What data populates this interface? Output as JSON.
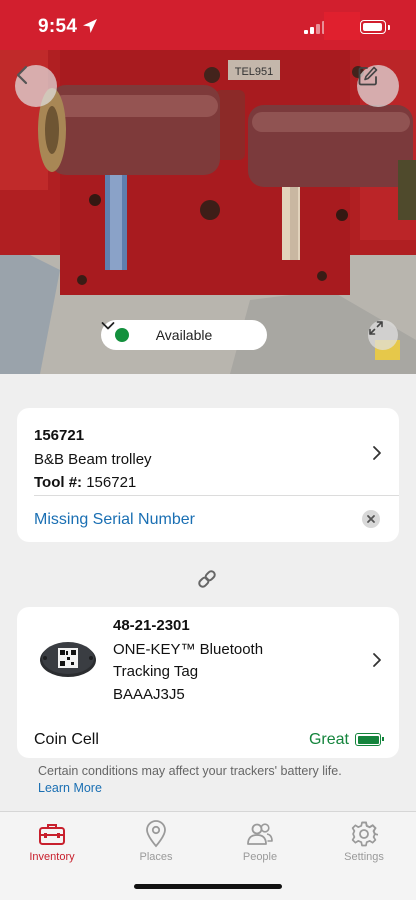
{
  "status_bar": {
    "time": "9:54"
  },
  "photo": {
    "label_text": "TEL951",
    "status_label": "Available",
    "status_color": "#13903d"
  },
  "tool": {
    "id": "156721",
    "name": "B&B Beam trolley",
    "tool_num_label": "Tool #:",
    "tool_num_value": "156721",
    "missing_serial": "Missing Serial Number"
  },
  "tracker": {
    "part_number": "48-21-2301",
    "name_line1": "ONE-KEY™ Bluetooth",
    "name_line2": "Tracking Tag",
    "serial": "BAAAJ3J5",
    "battery_type": "Coin Cell",
    "battery_status": "Great",
    "battery_color": "#14843c"
  },
  "disclaimer": "Certain conditions may affect your trackers' battery life.",
  "learn_more": "Learn More",
  "tabs": [
    {
      "label": "Inventory",
      "icon": "toolbox-icon",
      "active": true
    },
    {
      "label": "Places",
      "icon": "location-pin-icon",
      "active": false
    },
    {
      "label": "People",
      "icon": "people-icon",
      "active": false
    },
    {
      "label": "Settings",
      "icon": "gear-icon",
      "active": false
    }
  ],
  "colors": {
    "brand_red": "#d21f2e",
    "link_blue": "#1a6fb3"
  }
}
